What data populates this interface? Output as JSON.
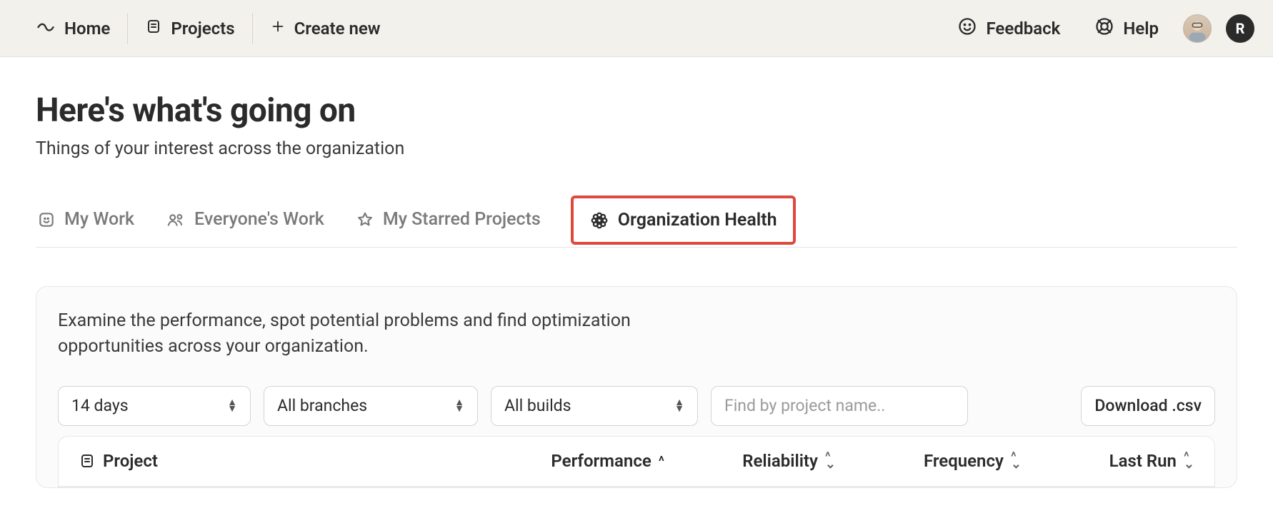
{
  "nav": {
    "home": "Home",
    "projects": "Projects",
    "create": "Create new",
    "feedback": "Feedback",
    "help": "Help",
    "avatar_letter": "R"
  },
  "header": {
    "title": "Here's what's going on",
    "subtitle": "Things of your interest across the organization"
  },
  "tabs": [
    {
      "label": "My Work"
    },
    {
      "label": "Everyone's Work"
    },
    {
      "label": "My Starred Projects"
    },
    {
      "label": "Organization Health"
    }
  ],
  "panel": {
    "description": "Examine the performance, spot potential problems and find optimization opportunities across your organization."
  },
  "filters": {
    "range": "14 days",
    "branches": "All branches",
    "builds": "All builds",
    "search_placeholder": "Find by project name..",
    "download": "Download .csv"
  },
  "columns": {
    "project": "Project",
    "performance": "Performance",
    "reliability": "Reliability",
    "frequency": "Frequency",
    "last_run": "Last Run"
  }
}
